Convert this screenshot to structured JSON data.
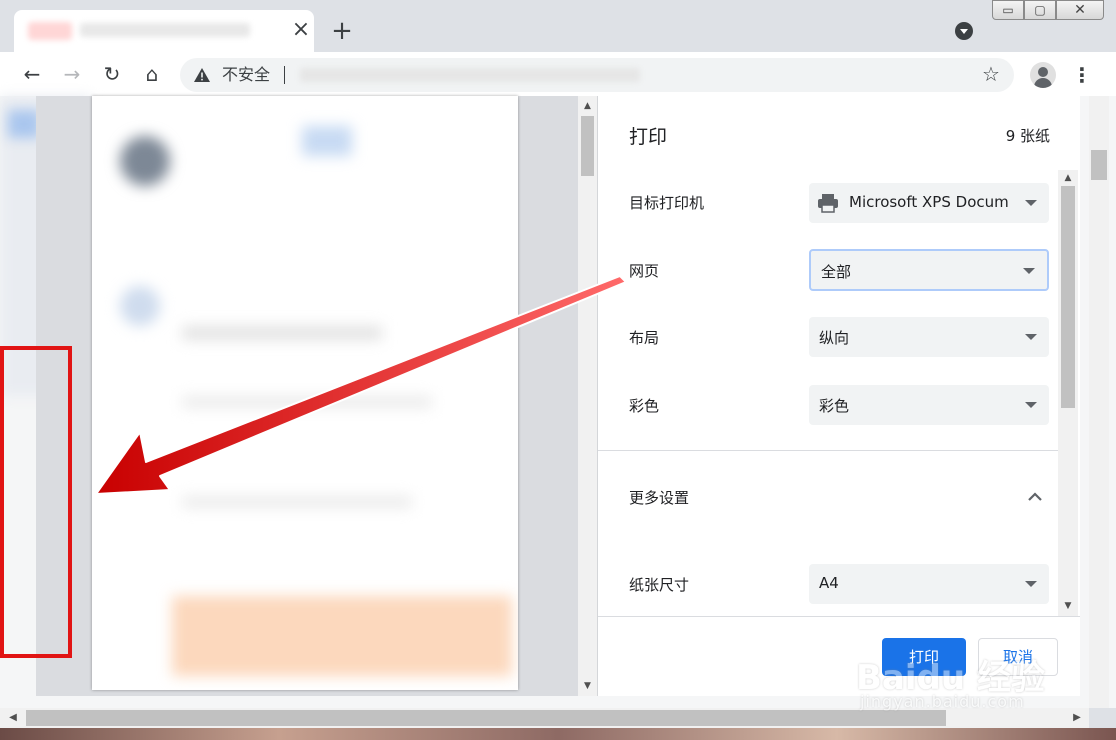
{
  "browser": {
    "tab_close": "×",
    "new_tab": "+",
    "window_controls": {
      "min": "▭",
      "max": "▢",
      "close": "✕"
    },
    "nav": {
      "back": "←",
      "forward": "→",
      "reload": "↻",
      "home": "⌂"
    },
    "omnibox": {
      "security_label": "不安全",
      "icon": "warning-triangle-icon"
    },
    "star": "☆",
    "menu": "⋮"
  },
  "print_dialog": {
    "title": "打印",
    "sheet_count": "9 张纸",
    "rows": [
      {
        "label": "目标打印机",
        "value": "Microsoft XPS Docum",
        "icon": "printer-icon"
      },
      {
        "label": "网页",
        "value": "全部"
      },
      {
        "label": "布局",
        "value": "纵向"
      },
      {
        "label": "彩色",
        "value": "彩色"
      }
    ],
    "more_settings": "更多设置",
    "paper_size": {
      "label": "纸张尺寸",
      "value": "A4"
    },
    "print_button": "打印",
    "cancel_button": "取消"
  },
  "scroll": {
    "up": "▲",
    "down": "▼",
    "left": "◀",
    "right": "▶"
  },
  "watermark": {
    "text": "Baidu 经验",
    "sub": "jingyan.baidu.com"
  },
  "colors": {
    "accent": "#1a73e8",
    "annotation": "#e11414",
    "chrome_bg": "#dee1e6"
  }
}
